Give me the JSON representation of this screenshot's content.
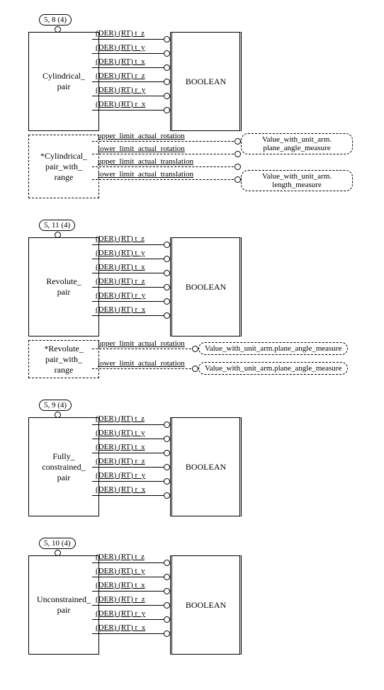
{
  "sections": [
    {
      "ref": "5, 8 (4)",
      "entity": "Cylindrical_\npair",
      "type": "BOOLEAN",
      "attrs": [
        "(DER) (RT) t_z",
        "(DER) (RT) t_y",
        "(DER) (RT) t_x",
        "(DER) (RT) r_z",
        "(DER) (RT) r_y",
        "(DER) (RT) r_x"
      ],
      "range_entity": "*Cylindrical_\npair_with_\nrange",
      "range_attrs": [
        "upper_limit_actual_rotation",
        "lower_limit_actual_rotation",
        "upper_limit_actual_translation",
        "lower_limit_actual_translation"
      ],
      "range_targets": [
        "Value_with_unit_arm.\nplane_angle_measure",
        "Value_with_unit_arm.\nlength_measure"
      ]
    },
    {
      "ref": "5, 11 (4)",
      "entity": "Revolute_\npair",
      "type": "BOOLEAN",
      "attrs": [
        "(DER) (RT) t_z",
        "(DER) (RT) t_y",
        "(DER) (RT) t_x",
        "(DER) (RT) r_z",
        "(DER) (RT) r_y",
        "(DER) (RT) r_x"
      ],
      "range_entity": "*Revolute_\npair_with_\nrange",
      "range_attrs": [
        "upper_limit_actual_rotation",
        "lower_limit_actual_rotation"
      ],
      "range_targets_single": [
        "Value_with_unit_arm.plane_angle_measure",
        "Value_with_unit_arm.plane_angle_measure"
      ]
    },
    {
      "ref": "5, 9 (4)",
      "entity": "Fully_\nconstrained_\npair",
      "type": "BOOLEAN",
      "attrs": [
        "(DER) (RT) t_z",
        "(DER) (RT) t_y",
        "(DER) (RT) t_x",
        "(DER) (RT) r_z",
        "(DER) (RT) r_y",
        "(DER) (RT) r_x"
      ]
    },
    {
      "ref": "5, 10 (4)",
      "entity": "Unconstrained_\npair",
      "type": "BOOLEAN",
      "attrs": [
        "(DER) (RT) t_z",
        "(DER) (RT) t_y",
        "(DER) (RT) t_x",
        "(DER) (RT) r_z",
        "(DER) (RT) r_y",
        "(DER) (RT) r_x"
      ]
    }
  ]
}
